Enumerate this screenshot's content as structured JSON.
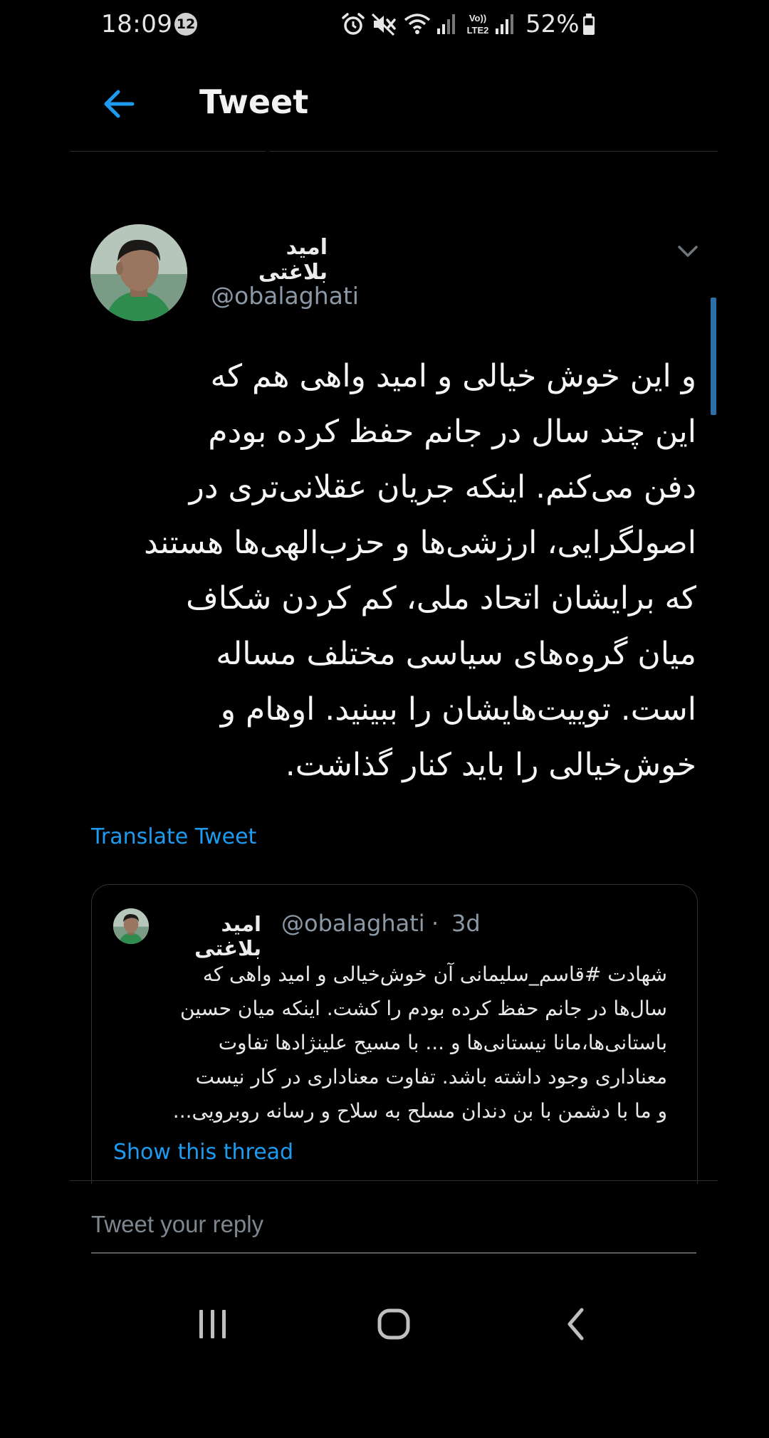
{
  "status_bar": {
    "time": "18:09",
    "notification_count": "12",
    "network_label": "Vo)) LTE2",
    "battery": "52%"
  },
  "header": {
    "title": "Tweet"
  },
  "tweet": {
    "author_name": "امید بلاغتی",
    "author_handle": "@obalaghati",
    "body_lines": [
      "و این خوش خیالی و امید واهی هم که",
      "این چند سال در جانم حفظ کرده بودم",
      "دفن می‌کنم. اینکه جریان عقلانی‌تری در",
      "اصولگرایی، ارزشی‌ها و حزب‌الهی‌ها هستند",
      "که برایشان اتحاد ملی، کم کردن شکاف",
      "میان گروه‌های سیاسی مختلف مساله",
      "است. توییت‌هایشان را ببینید. اوهام و",
      "خوش‌خیالی را باید کنار گذاشت."
    ],
    "translate_label": "Translate Tweet"
  },
  "quoted_tweet": {
    "author_name": "امید بلاغتی",
    "author_handle": "@obalaghati",
    "separator": "·",
    "date": "3d",
    "body_lines": [
      "شهادت #قاسم_سلیمانی آن خوش‌خیالی و امید واهی که",
      "سال‌ها در جانم حفظ کرده بودم را کشت. اینکه میان حسین",
      "باستانی‌ها،مانا نیستانی‌ها و ... با مسیح علینژادها تفاوت",
      "معناداری وجود داشته باشد. تفاوت معناداری در کار نیست",
      "و ما با دشمن با بن دندان مسلح به سلاح و رسانه روبرویی..."
    ],
    "show_thread_label": "Show this thread"
  },
  "reply": {
    "placeholder": "Tweet your reply"
  },
  "colors": {
    "background": "#000000",
    "accent_blue": "#1d9bf0",
    "secondary_text": "#8b98a5",
    "divider": "#2f3336"
  },
  "icons": {
    "back": "arrow-left-icon",
    "menu": "chevron-down-icon",
    "alarm": "alarm-icon",
    "mute": "mute-icon",
    "wifi": "wifi-icon",
    "signal": "signal-icon",
    "battery": "battery-icon",
    "nav_recents": "recents-icon",
    "nav_home": "home-icon",
    "nav_back": "nav-back-icon"
  }
}
